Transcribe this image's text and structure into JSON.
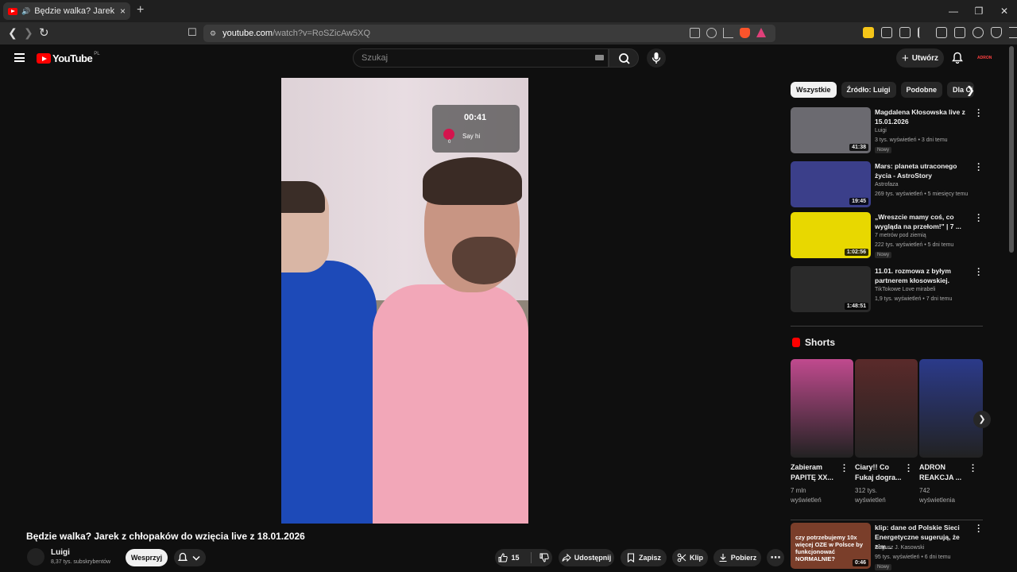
{
  "browser": {
    "tab_title": "Będzie walka? Jarek z chłopaków do wzięcia",
    "tab_close": "×",
    "new_tab": "+",
    "url_site": "youtube.com",
    "url_path": "/watch?v=RoSZicAw5XQ",
    "win_min": "—",
    "win_max": "❐",
    "win_close": "✕"
  },
  "header": {
    "logo_text": "YouTube",
    "logo_country": "PL",
    "search_placeholder": "Szukaj",
    "create_label": "Utwórz",
    "avatar_text": "ADRON"
  },
  "video": {
    "overlay_time": "00:41",
    "overlay_sayhi": "Say hi",
    "overlay_count": "0",
    "title": "Będzie walka? Jarek z chłopaków do wzięcia live z 18.01.2026",
    "channel": "Luigi",
    "subscribers": "8,37 tys. subskrybentów",
    "support_label": "Wesprzyj",
    "likes": "15",
    "share_label": "Udostępnij",
    "save_label": "Zapisz",
    "clip_label": "Klip",
    "download_label": "Pobierz"
  },
  "sidebar": {
    "chips": [
      "Wszystkie",
      "Źródło: Luigi",
      "Podobne",
      "Dla Ci"
    ],
    "recommendations": [
      {
        "title": "Magdalena Kłosowska live z 15.01.2026",
        "channel": "Luigi",
        "meta": "3 tys. wyświetleń • 3 dni temu",
        "badge": "Nowy",
        "duration": "41:38",
        "thumb_color": "#6b6a70"
      },
      {
        "title": "Mars: planeta utraconego życia - AstroStory",
        "channel": "Astrofaza",
        "meta": "269 tys. wyświetleń • 5 miesięcy temu",
        "badge": "",
        "duration": "19:45",
        "thumb_color": "#3b3f8a"
      },
      {
        "title": "„Wreszcie mamy coś, co wygląda na przełom!\" | 7 ...",
        "channel": "7 metrów pod ziemią",
        "meta": "222 tys. wyświetleń • 5 dni temu",
        "badge": "Nowy",
        "duration": "1:02:56",
        "thumb_color": "#e8d800"
      },
      {
        "title": "11.01. rozmowa z byłym partnerem kłosowskiej.",
        "channel": "TikTokowe Love mirabeli",
        "meta": "1,9 tys. wyświetleń • 7 dni temu",
        "badge": "",
        "duration": "1:48:51",
        "thumb_color": "#2a2a2a"
      }
    ],
    "shorts_title": "Shorts",
    "shorts": [
      {
        "title": "Zabieram PAPITĘ XX...",
        "views": "7 mln",
        "views2": "wyświetleń",
        "color": "#c04a8e"
      },
      {
        "title": "Ciary!! Co Fukaj dogra...",
        "views": "312 tys.",
        "views2": "wyświetleń",
        "color": "#5a2a2a"
      },
      {
        "title": "ADRON REAKCJA ...",
        "views": "742",
        "views2": "wyświetlenia",
        "color": "#2b3a8a"
      }
    ],
    "last_rec": {
      "title": "klip: dane od Polskie Sieci Energetyczne sugerują, że zim...",
      "channel": "Bogusz J. Kasowski",
      "meta": "95 tys. wyświetleń • 6 dni temu",
      "badge": "Nowy",
      "duration": "0:46",
      "thumb_text": "czy potrzebujemy 10x więcej OZE w Polsce by funkcjonować NORMALNIE?"
    }
  },
  "colors": {
    "accent": "#ff0000",
    "bg": "#0f0f0f",
    "surface": "#272727"
  }
}
